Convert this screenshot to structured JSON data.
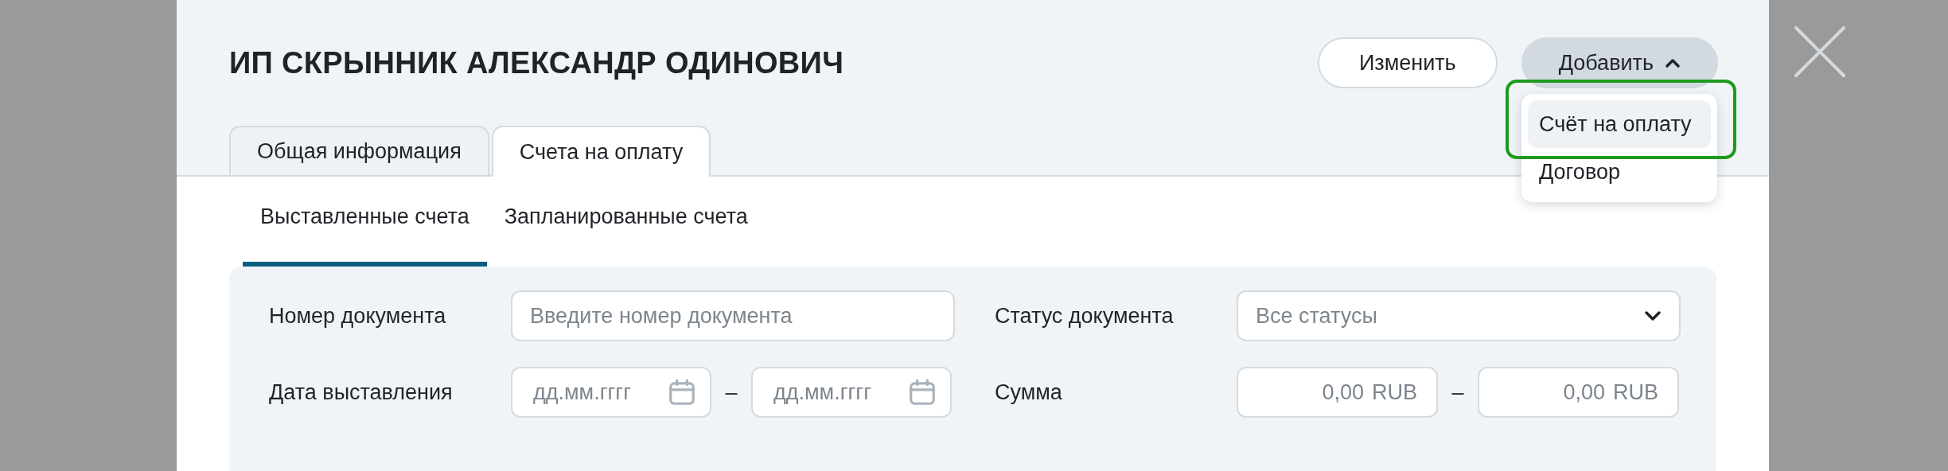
{
  "title": "ИП СКРЫННИК АЛЕКСАНДР ОДИНОВИЧ",
  "actions": [
    {
      "label": "Изменить",
      "kind": "plain"
    },
    {
      "label": "Добавить",
      "kind": "menu",
      "expanded": true
    }
  ],
  "add_menu": [
    {
      "label": "Счёт на оплату",
      "selected": true
    },
    {
      "label": "Договор",
      "selected": false
    }
  ],
  "tabs": [
    {
      "label": "Общая информация",
      "selected": false
    },
    {
      "label": "Счета на оплату",
      "selected": true
    }
  ],
  "subtabs": [
    {
      "label": "Выставленные счета",
      "selected": true
    },
    {
      "label": "Запланированные счета",
      "selected": false
    }
  ],
  "filters": {
    "document_number": {
      "label": "Номер документа",
      "placeholder": "Введите номер документа"
    },
    "status": {
      "label": "Статус документа",
      "placeholder": "Все статусы"
    },
    "issue_date": {
      "label": "Дата выставления",
      "from_placeholder": "дд.мм.гггг",
      "separator": "–",
      "to_placeholder": "дд.мм.гггг"
    },
    "amount": {
      "label": "Сумма",
      "from_placeholder": "0,00",
      "from_currency": "RUB",
      "separator": "–",
      "to_placeholder": "0,00",
      "to_currency": "RUB"
    }
  }
}
